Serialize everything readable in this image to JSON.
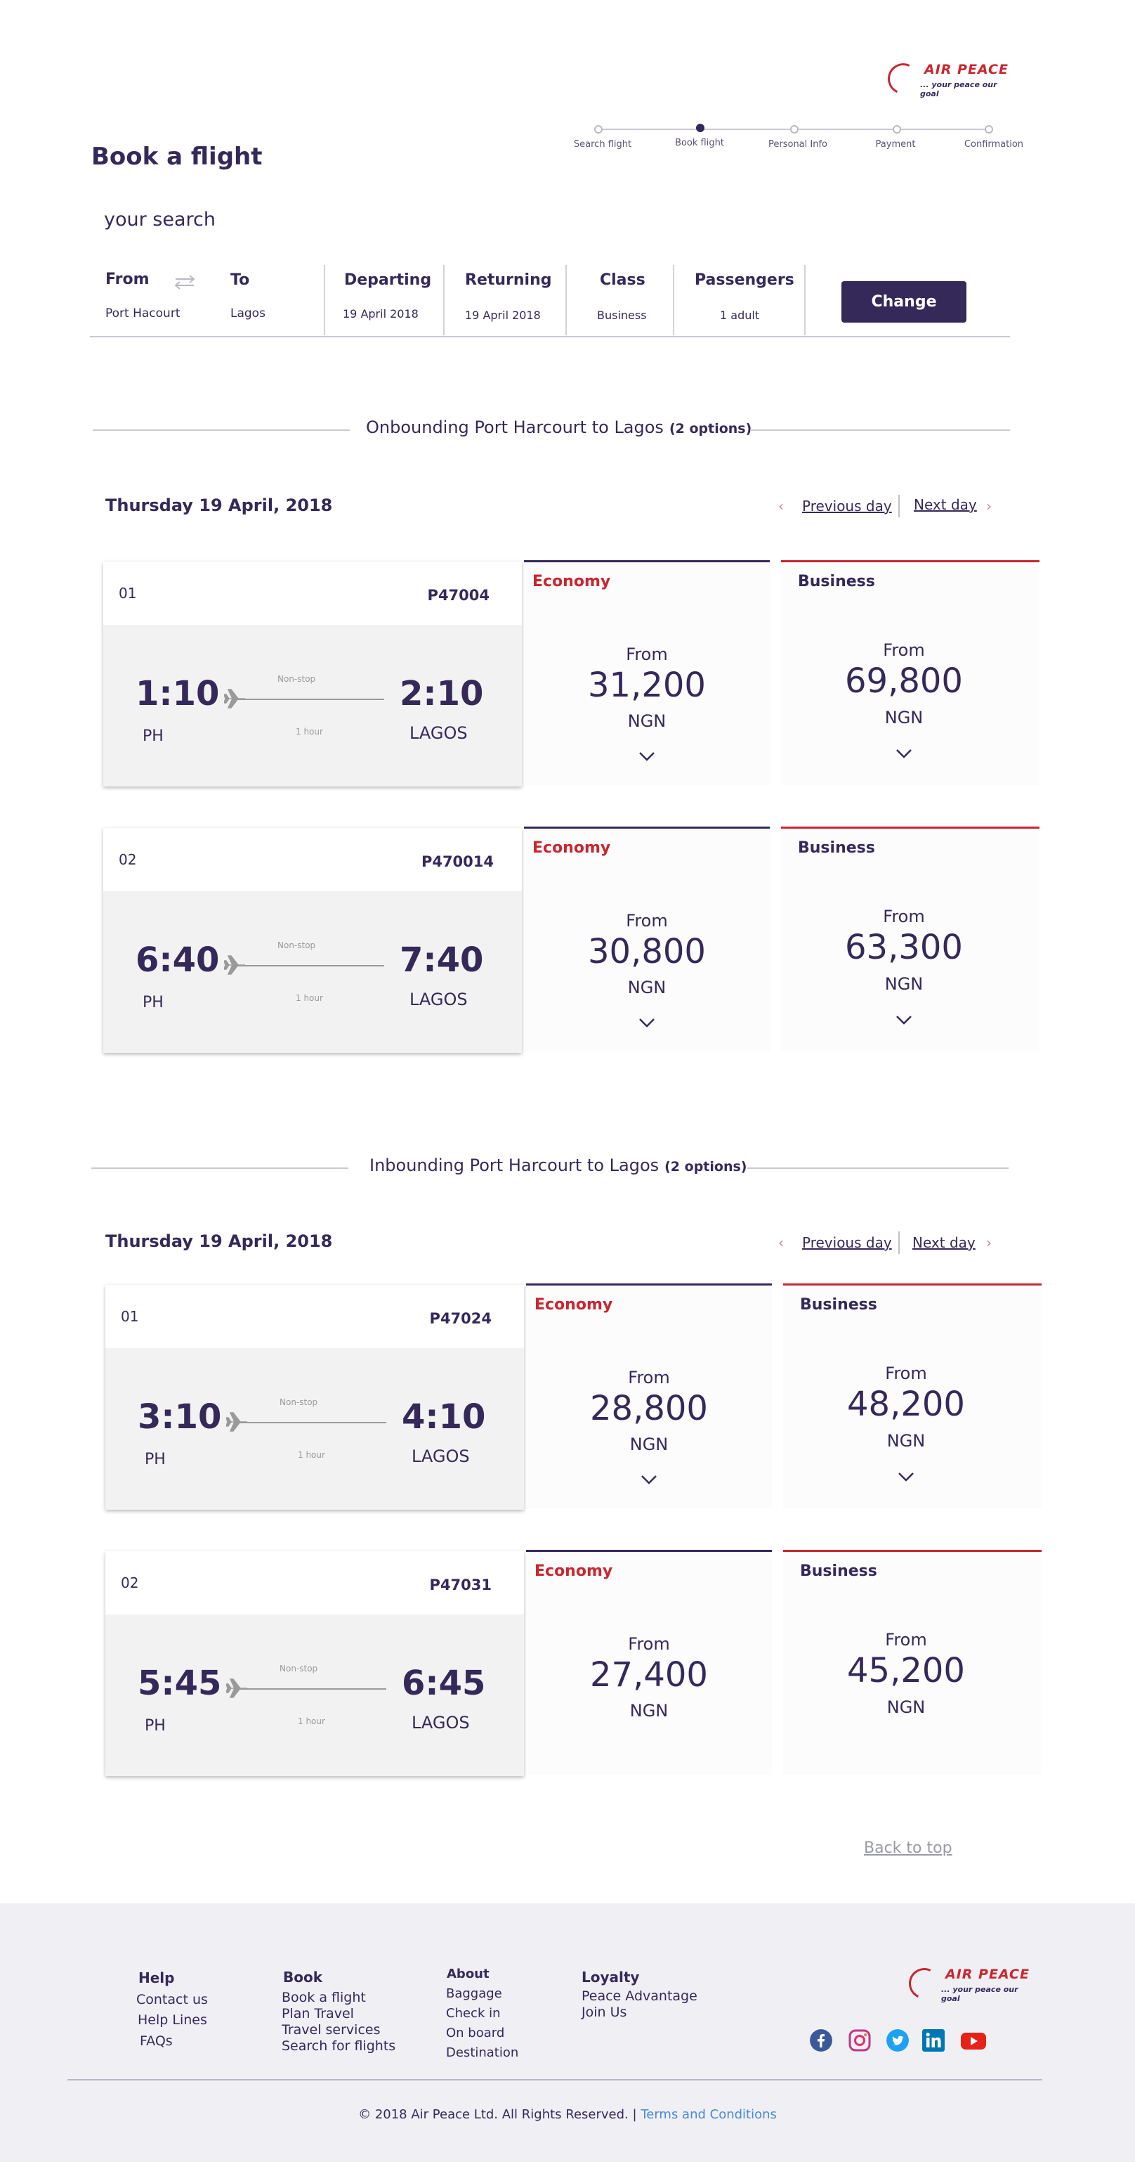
{
  "brand": {
    "name": "AIR PEACE",
    "tagline": "... your peace our goal"
  },
  "stepper": {
    "steps": [
      {
        "label": "Search flight",
        "active": false
      },
      {
        "label": "Book flight",
        "active": true
      },
      {
        "label": "Personal Info",
        "active": false
      },
      {
        "label": "Payment",
        "active": false
      },
      {
        "label": "Confirmation",
        "active": false
      }
    ]
  },
  "page_title": "Book a flight",
  "search": {
    "heading": "your search",
    "from_label": "From",
    "from_value": "Port Hacourt",
    "to_label": "To",
    "to_value": "Lagos",
    "departing_label": "Departing",
    "departing_value": "19 April 2018",
    "returning_label": "Returning",
    "returning_value": "19 April 2018",
    "class_label": "Class",
    "class_value": "Business",
    "passengers_label": "Passengers",
    "passengers_value": "1 adult",
    "change_label": "Change"
  },
  "outbound": {
    "title": "Onbounding Port Harcourt to Lagos",
    "count": "(2 options)",
    "date": "Thursday 19 April, 2018",
    "prev": "Previous day",
    "next": "Next day",
    "flights": [
      {
        "num": "01",
        "code": "P47004",
        "dep_time": "1:10",
        "arr_time": "2:10",
        "dep_place": "PH",
        "arr_place": "LAGOS",
        "stops": "Non-stop",
        "duration": "1 hour",
        "economy": {
          "label": "Economy",
          "from": "From",
          "price": "31,200",
          "currency": "NGN"
        },
        "business": {
          "label": "Business",
          "from": "From",
          "price": "69,800",
          "currency": "NGN"
        }
      },
      {
        "num": "02",
        "code": "P470014",
        "dep_time": "6:40",
        "arr_time": "7:40",
        "dep_place": "PH",
        "arr_place": "LAGOS",
        "stops": "Non-stop",
        "duration": "1 hour",
        "economy": {
          "label": "Economy",
          "from": "From",
          "price": "30,800",
          "currency": "NGN"
        },
        "business": {
          "label": "Business",
          "from": "From",
          "price": "63,300",
          "currency": "NGN"
        }
      }
    ]
  },
  "inbound": {
    "title": "Inbounding Port Harcourt to Lagos",
    "count": "(2 options)",
    "date": "Thursday 19 April, 2018",
    "prev": "Previous day",
    "next": "Next day",
    "flights": [
      {
        "num": "01",
        "code": "P47024",
        "dep_time": "3:10",
        "arr_time": "4:10",
        "dep_place": "PH",
        "arr_place": "LAGOS",
        "stops": "Non-stop",
        "duration": "1 hour",
        "economy": {
          "label": "Economy",
          "from": "From",
          "price": "28,800",
          "currency": "NGN"
        },
        "business": {
          "label": "Business",
          "from": "From",
          "price": "48,200",
          "currency": "NGN"
        }
      },
      {
        "num": "02",
        "code": "P47031",
        "dep_time": "5:45",
        "arr_time": "6:45",
        "dep_place": "PH",
        "arr_place": "LAGOS",
        "stops": "Non-stop",
        "duration": "1 hour",
        "economy": {
          "label": "Economy",
          "from": "From",
          "price": "27,400",
          "currency": "NGN"
        },
        "business": {
          "label": "Business",
          "from": "From",
          "price": "45,200",
          "currency": "NGN"
        }
      }
    ]
  },
  "back_to_top": "Back to top",
  "footer": {
    "help": {
      "heading": "Help",
      "links": [
        "Contact us",
        "Help Lines",
        "FAQs"
      ]
    },
    "book": {
      "heading": "Book",
      "links": [
        "Book a flight",
        "Plan Travel",
        "Travel services",
        "Search for flights"
      ]
    },
    "about": {
      "heading": "About",
      "links": [
        "Baggage",
        "Check in",
        "On board",
        "Destination"
      ]
    },
    "loyalty": {
      "heading": "Loyalty",
      "links": [
        "Peace Advantage",
        "Join Us"
      ]
    },
    "social": [
      "facebook-icon",
      "instagram-icon",
      "twitter-icon",
      "linkedin-icon",
      "youtube-icon"
    ],
    "copyright": "© 2018 Air Peace Ltd. All Rights Reserved. |",
    "terms": "Terms and Conditions"
  },
  "colors": {
    "primary": "#35295a",
    "accent_red": "#c9262e",
    "economy_label": "#c9262e",
    "business_label": "#35295a",
    "link_blue": "#4a8ad6"
  }
}
